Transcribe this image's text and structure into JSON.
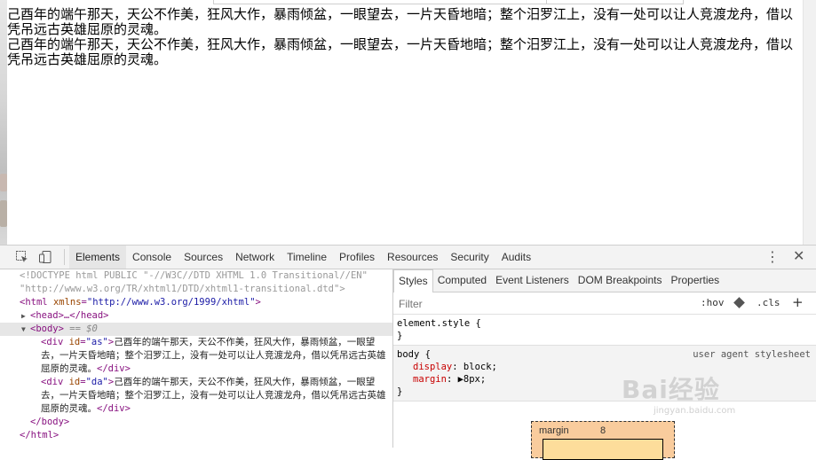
{
  "page": {
    "paragraphs": [
      "己酉年的端午那天，天公不作美，狂风大作，暴雨倾盆，一眼望去，一片天昏地暗；整个汨罗江上，没有一处可以让人竞渡龙舟，借以凭吊远古英雄屈原的灵魂。",
      "己酉年的端午那天，天公不作美，狂风大作，暴雨倾盆，一眼望去，一片天昏地暗；整个汨罗江上，没有一处可以让人竞渡龙舟，借以凭吊远古英雄屈原的灵魂。"
    ]
  },
  "devtools": {
    "tabs": [
      "Elements",
      "Console",
      "Sources",
      "Network",
      "Timeline",
      "Profiles",
      "Resources",
      "Security",
      "Audits"
    ],
    "active_tab": "Elements",
    "icons": {
      "inspect": "inspect-element-icon",
      "device": "device-mode-icon",
      "menu": "more-vertical-icon",
      "close": "close-icon"
    },
    "menu_glyph": "⋮",
    "close_glyph": "✕"
  },
  "tree": {
    "doctype_1": "<!DOCTYPE html PUBLIC \"-//W3C//DTD XHTML 1.0 Transitional//EN\"",
    "doctype_2": "\"http://www.w3.org/TR/xhtml1/DTD/xhtml1-transitional.dtd\">",
    "html_open_tag": "<html ",
    "html_attr_name": "xmlns",
    "html_attr_val": "\"http://www.w3.org/1999/xhtml\"",
    "html_close_bracket": ">",
    "head": "<head>…</head>",
    "body_open": "<body>",
    "body_eq": "== $0",
    "div1_open": "<div ",
    "div1_attr_name": "id",
    "div1_attr_val": "\"as\"",
    "div1_text": "己酉年的端午那天，天公不作美，狂风大作，暴雨倾盆，一眼望去，一片天昏地暗；整个汨罗江上，没有一处可以让人竞渡龙舟，借以凭吊远古英雄屈原的灵魂。",
    "div_close": "</div>",
    "div2_open": "<div ",
    "div2_attr_name": "id",
    "div2_attr_val": "\"da\"",
    "div2_text": "己酉年的端午那天，天公不作美，狂风大作，暴雨倾盆，一眼望去，一片天昏地暗；整个汨罗江上，没有一处可以让人竞渡龙舟，借以凭吊远古英雄屈原的灵魂。",
    "body_close": "</body>",
    "html_close": "</html>"
  },
  "styles": {
    "tabs": [
      "Styles",
      "Computed",
      "Event Listeners",
      "DOM Breakpoints",
      "Properties"
    ],
    "active_tab": "Styles",
    "filter_placeholder": "Filter",
    "hov": ":hov",
    "cls": ".cls",
    "plus": "+",
    "element_style_open": "element.style {",
    "element_style_close": "}",
    "body_rule_selector": "body {",
    "body_rule_source": "user agent stylesheet",
    "prop_display_name": "display",
    "prop_display_value": "block;",
    "prop_margin_name": "margin",
    "prop_margin_value": "▶8px;",
    "rule_close": "}",
    "boxmodel_label": "margin",
    "boxmodel_value": "8"
  },
  "watermark": {
    "brand": "Bai经验",
    "url": "jingyan.baidu.com"
  }
}
